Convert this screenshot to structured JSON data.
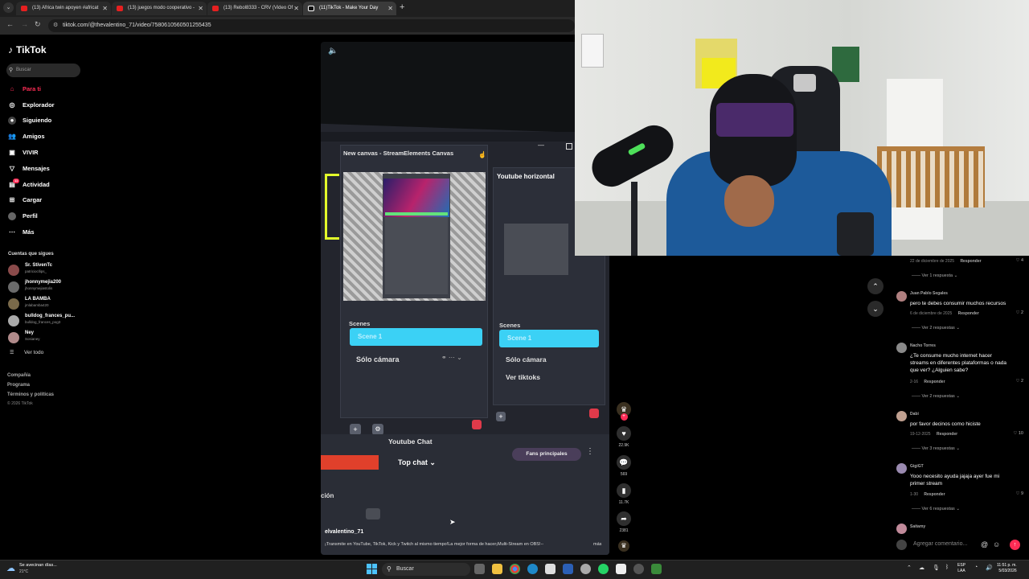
{
  "browser": {
    "tabs": [
      {
        "title": "(13) Africa twin apoyen #africat",
        "icon": "youtube-icon",
        "active": false
      },
      {
        "title": "(13) juegos modo cooperativo -",
        "icon": "youtube-icon",
        "active": false
      },
      {
        "title": "(13) Rebol8333 - CRV (Video Of",
        "icon": "youtube-icon",
        "active": false
      },
      {
        "title": "(11)TikTok - Make Your Day",
        "icon": "tiktok-icon",
        "active": true
      }
    ],
    "url": "tiktok.com/@thevalentino_71/video/7580610560501255435"
  },
  "sidebar": {
    "logo": "TikTok",
    "search_placeholder": "Buscar",
    "nav": [
      {
        "label": "Para ti",
        "icon": "home-icon",
        "active": true
      },
      {
        "label": "Explorador",
        "icon": "compass-icon"
      },
      {
        "label": "Siguiendo",
        "icon": "following-icon"
      },
      {
        "label": "Amigos",
        "icon": "friends-icon"
      },
      {
        "label": "VIVIR",
        "icon": "live-icon"
      },
      {
        "label": "Mensajes",
        "icon": "messages-icon"
      },
      {
        "label": "Actividad",
        "icon": "activity-icon",
        "badge": "11"
      },
      {
        "label": "Cargar",
        "icon": "upload-icon"
      },
      {
        "label": "Perfil",
        "icon": "profile-icon"
      },
      {
        "label": "Más",
        "icon": "more-icon"
      }
    ],
    "following_title": "Cuentas que sigues",
    "accounts": [
      {
        "name": "Sr. StivenTc",
        "handle": "patriciocllips_"
      },
      {
        "name": "jhonnymejia200",
        "handle": "jhonnymejiastolis"
      },
      {
        "name": "LA BAMBA",
        "handle": "jmlabamba420"
      },
      {
        "name": "bulldog_frances_pu...",
        "handle": "bulldog_frances_pog3"
      },
      {
        "name": "Ney",
        "handle": "Sosianey"
      }
    ],
    "see_all": "Ver todo",
    "footer": [
      "Compañía",
      "Programa",
      "Términos y políticas"
    ],
    "copyright": "© 2026 TikTok"
  },
  "video": {
    "canvas_title": "New canvas - StreamElements Canvas",
    "horizontal_title": "Youtube horizontal",
    "scenes_label": "Scenes",
    "scene_items_left": [
      "Scene 1",
      "Sólo cámara"
    ],
    "scene_items_right": [
      "Scene 1",
      "Sólo cámara",
      "Ver tiktoks"
    ],
    "chat_title": "Youtube Chat",
    "top_chat": "Top chat",
    "fans_label": "Fans principales",
    "side_text": "ción",
    "author": "elvalentino_71",
    "caption": "¡Transmite en YouTube, TikTok, Kick y Twitch al mismo tiempo!La mejor forma de hacer¡Multi-Stream en OBS!--",
    "more": "más"
  },
  "actions": {
    "likes": "22.9K",
    "comments": "569",
    "saves": "11.7K",
    "shares": "2381"
  },
  "comments": {
    "items": [
      {
        "name": "",
        "text": "",
        "date": "22 de diciembre de 2025",
        "reply": "Responder",
        "likes": "4",
        "replies": "Ver 1 respuesta"
      },
      {
        "name": "Juan Pablo Segales",
        "text": "pero te debes consumir muchos recursos",
        "date": "6 de diciembre de 2025",
        "reply": "Responder",
        "likes": "2",
        "replies": "Ver 2 respuestas"
      },
      {
        "name": "Nacho Torres",
        "text": "¿Te consume mucho internet hacer streams en diferentes plataformas o nada que ver? ¿Alguien sabe?",
        "date": "2-16",
        "reply": "Responder",
        "likes": "2",
        "replies": "Ver 2 respuestas"
      },
      {
        "name": "Dabi",
        "text": "por favor decinos como hiciste",
        "date": "19-12-2025",
        "reply": "Responder",
        "likes": "10",
        "replies": "Ver 3 respuestas"
      },
      {
        "name": "GigiGT",
        "text": "Yooo necesito ayuda jajaja ayer fue mi primer stream",
        "date": "1-30",
        "reply": "Responder",
        "likes": "9",
        "replies": "Ver 6 respuestas"
      },
      {
        "name": "Saitamy",
        "text": "",
        "date": "",
        "reply": "",
        "likes": "",
        "replies": ""
      }
    ],
    "input_placeholder": "Agregar comentario..."
  },
  "taskbar": {
    "weather_text": "Se avecinan días...",
    "temp": "21°C",
    "search": "Buscar",
    "lang": "ESP",
    "lang2": "LAA",
    "time": "11:51 p. m.",
    "date": "5/03/2026"
  },
  "colors": {
    "accent": "#fe2c55",
    "obs_highlight": "#3bd1f5",
    "obs_bg": "#2b2e38"
  }
}
